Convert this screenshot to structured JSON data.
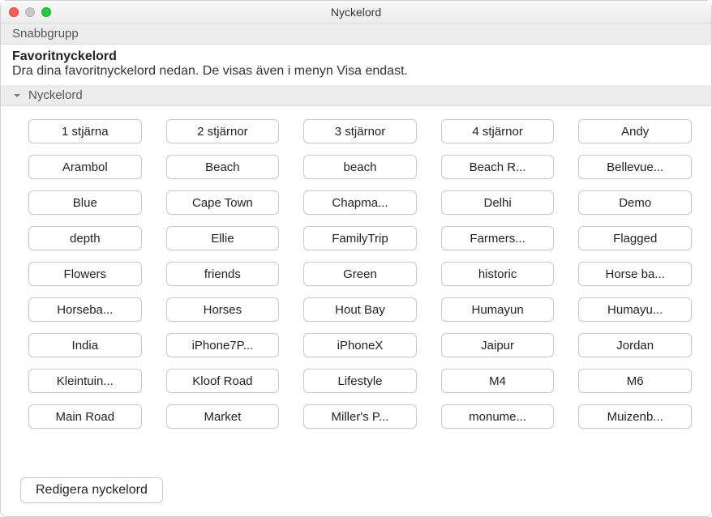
{
  "window": {
    "title": "Nyckelord"
  },
  "sections": {
    "snabbgrupp_label": "Snabbgrupp",
    "nyckelord_label": "Nyckelord"
  },
  "favorites": {
    "title": "Favoritnyckelord",
    "subtitle": "Dra dina favoritnyckelord nedan. De visas även i menyn Visa endast."
  },
  "keywords": [
    "1 stjärna",
    "2 stjärnor",
    "3 stjärnor",
    "4 stjärnor",
    "Andy",
    "Arambol",
    "Beach",
    "beach",
    "Beach R...",
    "Bellevue...",
    "Blue",
    "Cape Town",
    "Chapma...",
    "Delhi",
    "Demo",
    "depth",
    "Ellie",
    "FamilyTrip",
    "Farmers...",
    "Flagged",
    "Flowers",
    "friends",
    "Green",
    "historic",
    "Horse ba...",
    "Horseba...",
    "Horses",
    "Hout Bay",
    "Humayun",
    "Humayu...",
    "India",
    "iPhone7P...",
    "iPhoneX",
    "Jaipur",
    "Jordan",
    "Kleintuin...",
    "Kloof Road",
    "Lifestyle",
    "M4",
    "M6",
    "Main Road",
    "Market",
    "Miller's P...",
    "monume...",
    "Muizenb..."
  ],
  "footer": {
    "edit_label": "Redigera nyckelord"
  }
}
